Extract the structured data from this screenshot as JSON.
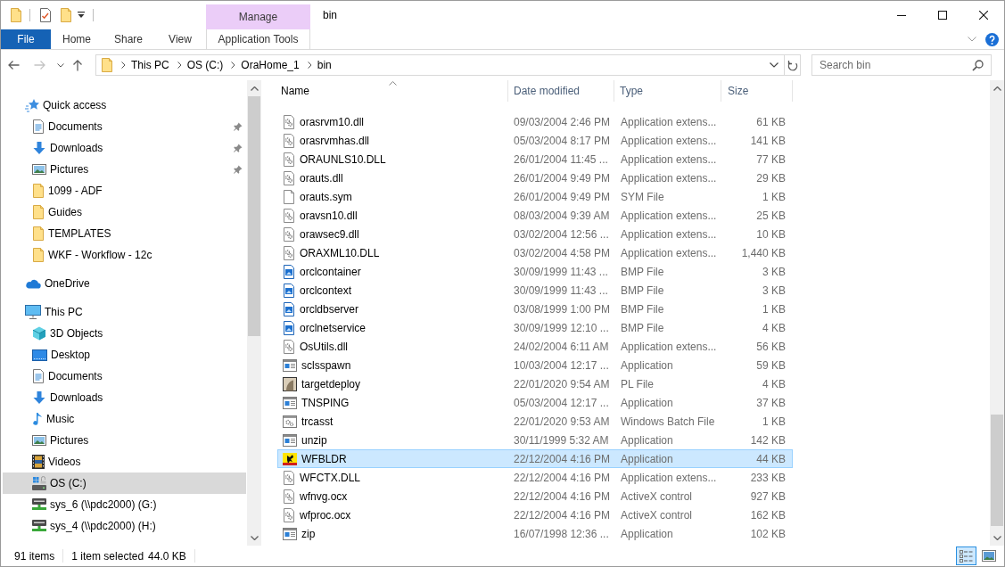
{
  "window": {
    "title": "bin",
    "context_group": "Manage"
  },
  "ribbon": {
    "tabs": [
      {
        "label": "File",
        "kind": "file"
      },
      {
        "label": "Home",
        "kind": "plain"
      },
      {
        "label": "Share",
        "kind": "plain"
      },
      {
        "label": "View",
        "kind": "plain"
      },
      {
        "label": "Application Tools",
        "kind": "contextual"
      }
    ]
  },
  "navigation": [
    {
      "kind": "back",
      "disabled": false
    },
    {
      "kind": "forward",
      "disabled": true
    },
    {
      "kind": "recent",
      "disabled": false
    },
    {
      "kind": "up",
      "disabled": false
    }
  ],
  "address_bar": {
    "crumbs": [
      "This PC",
      "OS (C:)",
      "OraHome_1",
      "bin"
    ]
  },
  "search": {
    "placeholder": "Search bin"
  },
  "nav_pane": {
    "items": [
      {
        "label": "Quick access",
        "kind": "star",
        "selected": false,
        "children": [
          {
            "label": "Documents",
            "kind": "documents",
            "pinned": true,
            "selected": false
          },
          {
            "label": "Downloads",
            "kind": "downloads",
            "pinned": true,
            "selected": false
          },
          {
            "label": "Pictures",
            "kind": "pictures",
            "pinned": true,
            "selected": false
          },
          {
            "label": "1099 - ADF",
            "kind": "folder",
            "pinned": false,
            "selected": false
          },
          {
            "label": "Guides",
            "kind": "folder",
            "pinned": false,
            "selected": false
          },
          {
            "label": "TEMPLATES",
            "kind": "folder",
            "pinned": false,
            "selected": false
          },
          {
            "label": "WKF - Workflow - 12c",
            "kind": "folder",
            "pinned": false,
            "selected": false
          }
        ]
      },
      {
        "label": "OneDrive",
        "kind": "cloud",
        "selected": false
      },
      {
        "label": "This PC",
        "kind": "pc",
        "selected": false,
        "children": [
          {
            "label": "3D Objects",
            "kind": "cube",
            "selected": false
          },
          {
            "label": "Desktop",
            "kind": "desktop",
            "selected": false
          },
          {
            "label": "Documents",
            "kind": "documents",
            "selected": false
          },
          {
            "label": "Downloads",
            "kind": "downloads",
            "selected": false
          },
          {
            "label": "Music",
            "kind": "music",
            "selected": false
          },
          {
            "label": "Pictures",
            "kind": "pictures",
            "selected": false
          },
          {
            "label": "Videos",
            "kind": "videos",
            "selected": false
          },
          {
            "label": "OS (C:)",
            "kind": "system-drive",
            "selected": true
          },
          {
            "label": "sys_6 (\\\\pdc2000) (G:)",
            "kind": "network-drive",
            "selected": false
          },
          {
            "label": "sys_4 (\\\\pdc2000) (H:)",
            "kind": "network-drive",
            "selected": false
          }
        ]
      }
    ]
  },
  "file_list": {
    "columns": [
      {
        "label": "Name",
        "sorted": true
      },
      {
        "label": "Date modified",
        "sorted": false
      },
      {
        "label": "Type",
        "sorted": false
      },
      {
        "label": "Size",
        "sorted": false
      }
    ],
    "rows": [
      {
        "name": "orasrvm10.dll",
        "date": "09/03/2004 2:46 PM",
        "type": "Application extens...",
        "size": "61 KB",
        "kind": "dll",
        "selected": false
      },
      {
        "name": "orasrvmhas.dll",
        "date": "05/03/2004 8:17 PM",
        "type": "Application extens...",
        "size": "141 KB",
        "kind": "dll",
        "selected": false
      },
      {
        "name": "ORAUNLS10.DLL",
        "date": "26/01/2004 11:45 ...",
        "type": "Application extens...",
        "size": "77 KB",
        "kind": "dll",
        "selected": false
      },
      {
        "name": "orauts.dll",
        "date": "26/01/2004 9:49 PM",
        "type": "Application extens...",
        "size": "29 KB",
        "kind": "dll",
        "selected": false
      },
      {
        "name": "orauts.sym",
        "date": "26/01/2004 9:49 PM",
        "type": "SYM File",
        "size": "1 KB",
        "kind": "file",
        "selected": false
      },
      {
        "name": "oravsn10.dll",
        "date": "08/03/2004 9:39 AM",
        "type": "Application extens...",
        "size": "25 KB",
        "kind": "dll",
        "selected": false
      },
      {
        "name": "orawsec9.dll",
        "date": "03/02/2004 12:56 ...",
        "type": "Application extens...",
        "size": "10 KB",
        "kind": "dll",
        "selected": false
      },
      {
        "name": "ORAXML10.DLL",
        "date": "03/02/2004 4:58 PM",
        "type": "Application extens...",
        "size": "1,440 KB",
        "kind": "dll",
        "selected": false
      },
      {
        "name": "orclcontainer",
        "date": "30/09/1999 11:43 ...",
        "type": "BMP File",
        "size": "3 KB",
        "kind": "bmp",
        "selected": false
      },
      {
        "name": "orclcontext",
        "date": "30/09/1999 11:43 ...",
        "type": "BMP File",
        "size": "3 KB",
        "kind": "bmp",
        "selected": false
      },
      {
        "name": "orcldbserver",
        "date": "03/08/1999 1:00 PM",
        "type": "BMP File",
        "size": "1 KB",
        "kind": "bmp",
        "selected": false
      },
      {
        "name": "orclnetservice",
        "date": "30/09/1999 12:10 ...",
        "type": "BMP File",
        "size": "4 KB",
        "kind": "bmp",
        "selected": false
      },
      {
        "name": "OsUtils.dll",
        "date": "24/02/2004 6:11 AM",
        "type": "Application extens...",
        "size": "56 KB",
        "kind": "dll",
        "selected": false
      },
      {
        "name": "sclsspawn",
        "date": "10/03/2004 12:17 ...",
        "type": "Application",
        "size": "59 KB",
        "kind": "exe",
        "selected": false
      },
      {
        "name": "targetdeploy",
        "date": "22/01/2020 9:54 AM",
        "type": "PL File",
        "size": "4 KB",
        "kind": "pl",
        "selected": false
      },
      {
        "name": "TNSPING",
        "date": "05/03/2004 12:17 ...",
        "type": "Application",
        "size": "37 KB",
        "kind": "exe",
        "selected": false
      },
      {
        "name": "trcasst",
        "date": "22/01/2020 9:53 AM",
        "type": "Windows Batch File",
        "size": "1 KB",
        "kind": "bat",
        "selected": false
      },
      {
        "name": "unzip",
        "date": "30/11/1999 5:32 AM",
        "type": "Application",
        "size": "142 KB",
        "kind": "exe",
        "selected": false
      },
      {
        "name": "WFBLDR",
        "date": "22/12/2004 4:16 PM",
        "type": "Application",
        "size": "44 KB",
        "kind": "logo-app",
        "selected": true
      },
      {
        "name": "WFCTX.DLL",
        "date": "22/12/2004 4:16 PM",
        "type": "Application extens...",
        "size": "233 KB",
        "kind": "dll",
        "selected": false
      },
      {
        "name": "wfnvg.ocx",
        "date": "22/12/2004 4:16 PM",
        "type": "ActiveX control",
        "size": "927 KB",
        "kind": "dll",
        "selected": false
      },
      {
        "name": "wfproc.ocx",
        "date": "22/12/2004 4:16 PM",
        "type": "ActiveX control",
        "size": "162 KB",
        "kind": "dll",
        "selected": false
      },
      {
        "name": "zip",
        "date": "16/07/1998 12:36 ...",
        "type": "Application",
        "size": "102 KB",
        "kind": "exe",
        "selected": false
      }
    ]
  },
  "status_bar": {
    "item_count": "91 items",
    "selection": "1 item selected",
    "selection_size": "44.0 KB",
    "views": [
      {
        "kind": "details",
        "selected": true
      },
      {
        "kind": "large-icons",
        "selected": false
      }
    ]
  }
}
